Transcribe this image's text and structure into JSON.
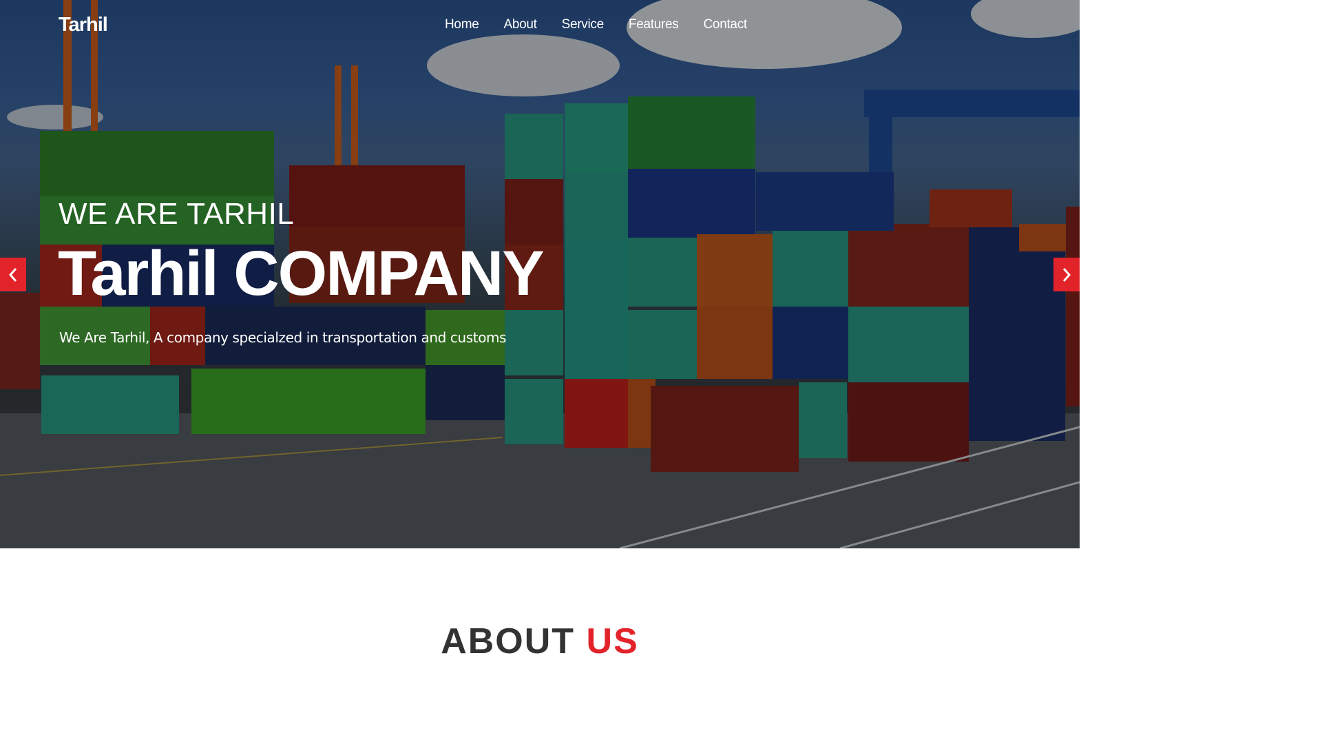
{
  "brand": {
    "name": "Tarhil"
  },
  "nav": {
    "items": [
      "Home",
      "About",
      "Service",
      "Features",
      "Contact"
    ]
  },
  "hero": {
    "eyebrow": "WE ARE TARHIL",
    "headline": "Tarhil COMPANY",
    "subline": "We Are Tarhil, A company specialzed in transportation and customs",
    "prev_icon": "chevron-left-icon",
    "next_icon": "chevron-right-icon"
  },
  "about": {
    "title_part1": "ABOUT ",
    "title_part2": "US"
  },
  "colors": {
    "accent": "#e2232a",
    "text_light": "#ffffff",
    "heading_dark": "#333333"
  }
}
